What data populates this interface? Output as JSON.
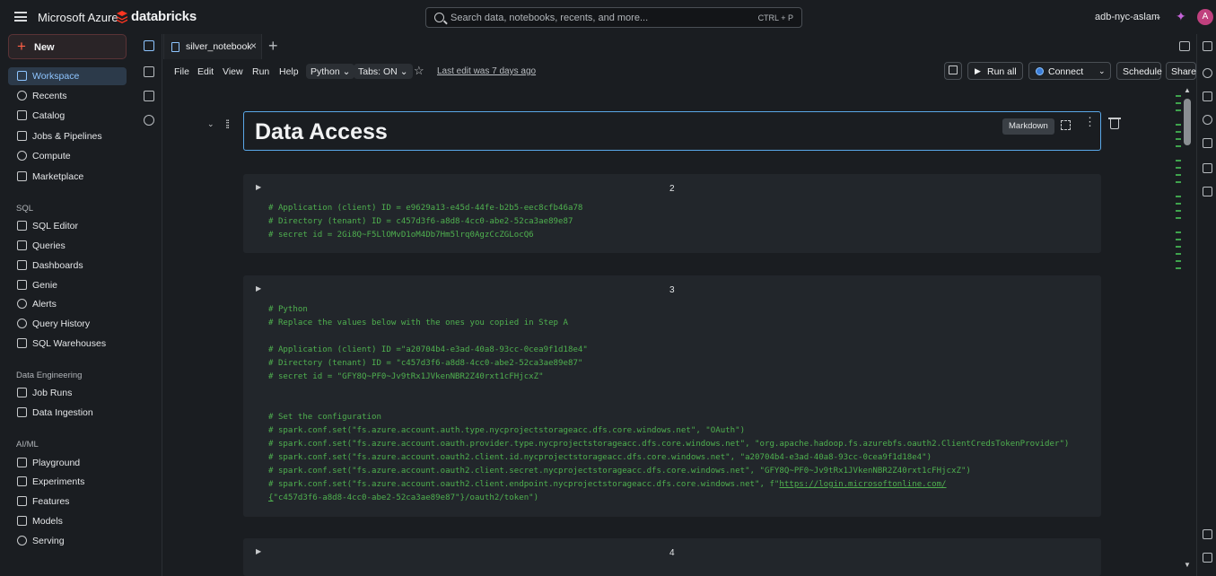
{
  "topbar": {
    "brand_azure": "Microsoft Azure",
    "brand_databricks": "databricks",
    "search_placeholder": "Search data, notebooks, recents, and more...",
    "search_shortcut": "CTRL + P",
    "workspace": "adb-nyc-aslam",
    "avatar_initial": "A"
  },
  "sidebar": {
    "new_label": "New",
    "items_main": [
      {
        "label": "Workspace",
        "icon": "workspace-icon"
      },
      {
        "label": "Recents",
        "icon": "clock-icon"
      },
      {
        "label": "Catalog",
        "icon": "catalog-icon"
      },
      {
        "label": "Jobs & Pipelines",
        "icon": "jobs-icon"
      },
      {
        "label": "Compute",
        "icon": "cloud-icon"
      },
      {
        "label": "Marketplace",
        "icon": "store-icon"
      }
    ],
    "sql_heading": "SQL",
    "items_sql": [
      {
        "label": "SQL Editor",
        "icon": "sql-editor-icon"
      },
      {
        "label": "Queries",
        "icon": "queries-icon"
      },
      {
        "label": "Dashboards",
        "icon": "dashboard-icon"
      },
      {
        "label": "Genie",
        "icon": "genie-icon"
      },
      {
        "label": "Alerts",
        "icon": "bell-icon"
      },
      {
        "label": "Query History",
        "icon": "history-icon"
      },
      {
        "label": "SQL Warehouses",
        "icon": "warehouse-icon"
      }
    ],
    "de_heading": "Data Engineering",
    "items_de": [
      {
        "label": "Job Runs",
        "icon": "job-runs-icon"
      },
      {
        "label": "Data Ingestion",
        "icon": "ingestion-icon"
      }
    ],
    "ml_heading": "AI/ML",
    "items_ml": [
      {
        "label": "Playground",
        "icon": "playground-icon"
      },
      {
        "label": "Experiments",
        "icon": "experiments-icon"
      },
      {
        "label": "Features",
        "icon": "features-icon"
      },
      {
        "label": "Models",
        "icon": "models-icon"
      },
      {
        "label": "Serving",
        "icon": "serving-icon"
      }
    ]
  },
  "tabs": {
    "active_tab": "silver_notebook",
    "close_glyph": "×",
    "add_glyph": "+"
  },
  "menu": {
    "file": "File",
    "edit": "Edit",
    "view": "View",
    "run": "Run",
    "help": "Help",
    "language": "Python",
    "tabs_setting": "Tabs: ON",
    "last_edit": "Last edit was 7 days ago",
    "run_all": "Run all",
    "connect": "Connect",
    "schedule": "Schedule",
    "share": "Share"
  },
  "cells": {
    "markdown": {
      "title": "Data Access",
      "badge": "Markdown"
    },
    "cell2": {
      "number": "2",
      "lines": [
        "# Application (client) ID = e9629a13-e45d-44fe-b2b5-eec8cfb46a78",
        "# Directory (tenant) ID = c457d3f6-a8d8-4cc0-abe2-52ca3ae89e87",
        "# secret id = 2Gi8Q~F5LlOMvD1oM4Db7Hm5lrq0AgzCcZGLocQ6"
      ]
    },
    "cell3": {
      "number": "3",
      "lines": [
        "# Python",
        "# Replace the values below with the ones you copied in Step A",
        "",
        "# Application (client) ID =\"a20704b4-e3ad-40a8-93cc-0cea9f1d18e4\"",
        "# Directory (tenant) ID = \"c457d3f6-a8d8-4cc0-abe2-52ca3ae89e87\"",
        "# secret id = \"GFY8Q~PF0~Jv9tRx1JVkenNBR2Z40rxt1cFHjcxZ\"",
        "",
        "",
        "# Set the configuration",
        "# spark.conf.set(\"fs.azure.account.auth.type.nycprojectstorageacc.dfs.core.windows.net\", \"OAuth\")",
        "# spark.conf.set(\"fs.azure.account.oauth.provider.type.nycprojectstorageacc.dfs.core.windows.net\", \"org.apache.hadoop.fs.azurebfs.oauth2.ClientCredsTokenProvider\")",
        "# spark.conf.set(\"fs.azure.account.oauth2.client.id.nycprojectstorageacc.dfs.core.windows.net\", \"a20704b4-e3ad-40a8-93cc-0cea9f1d18e4\")",
        "# spark.conf.set(\"fs.azure.account.oauth2.client.secret.nycprojectstorageacc.dfs.core.windows.net\", \"GFY8Q~PF0~Jv9tRx1JVkenNBR2Z40rxt1cFHjcxZ\")"
      ],
      "endpoint_prefix": "# spark.conf.set(\"fs.azure.account.oauth2.client.endpoint.nycprojectstorageacc.dfs.core.windows.net\", f\"",
      "endpoint_link": "https://login.microsoftonline.com/",
      "endpoint_cont_link": "{",
      "endpoint_cont_rest": "\"c457d3f6-a8d8-4cc0-abe2-52ca3ae89e87\"}/oauth2/token\")"
    },
    "cell4": {
      "number": "4"
    }
  },
  "colors": {
    "accent": "#8ec5ff",
    "code_comment": "#4fb04f",
    "new_plus": "#ff5f46",
    "avatar": "#c0407e"
  }
}
